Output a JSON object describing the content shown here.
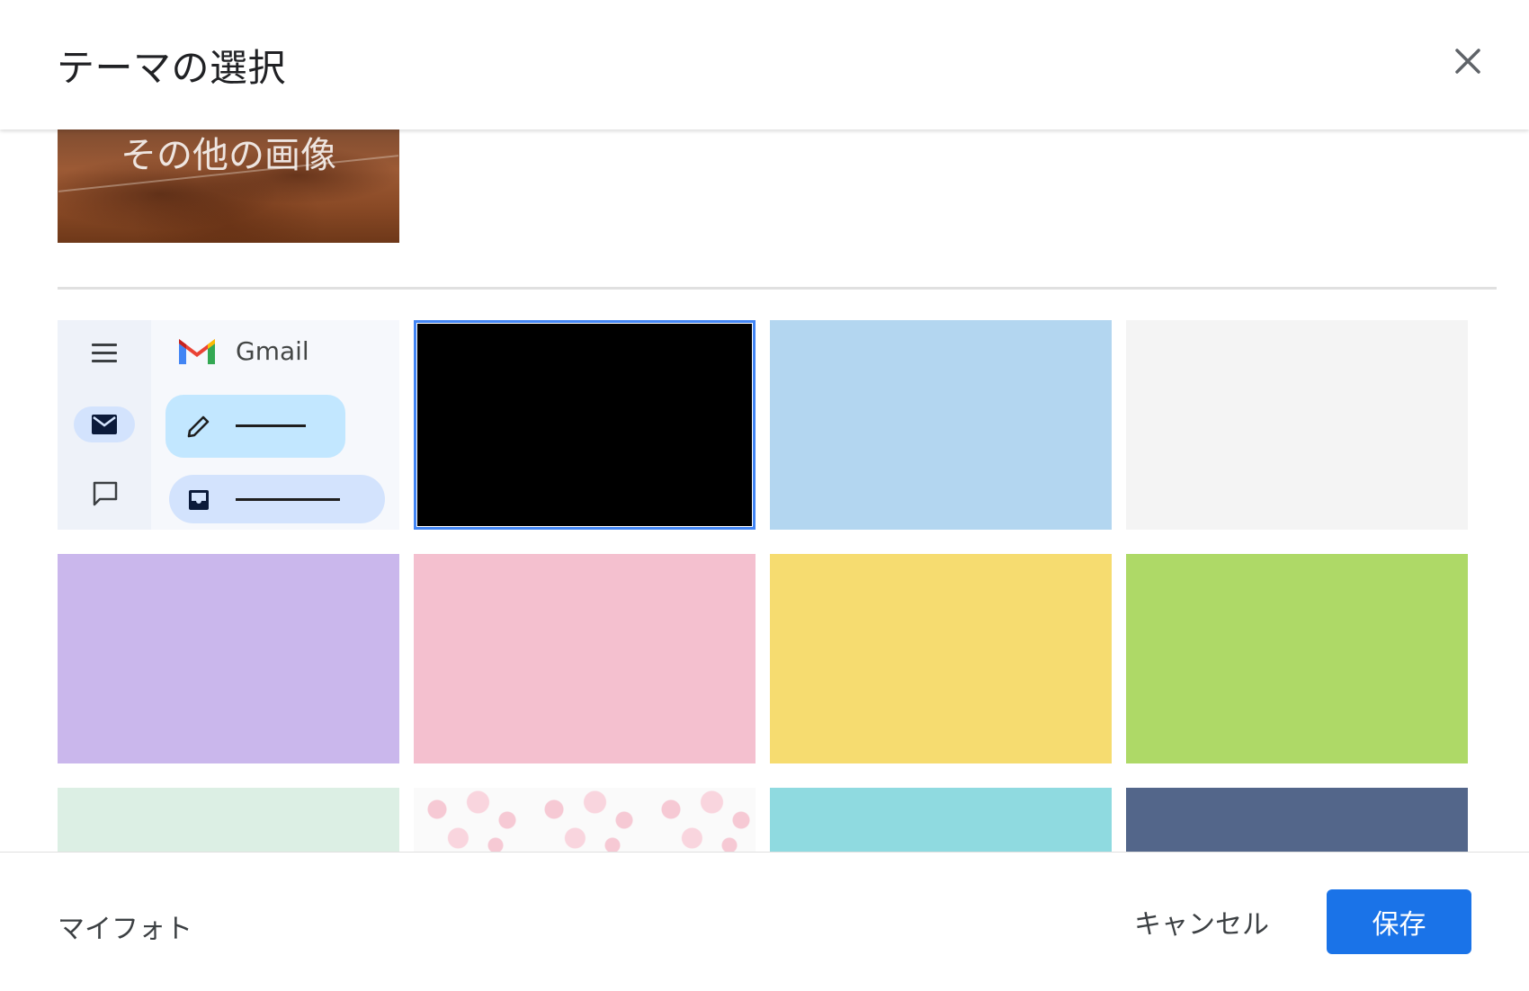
{
  "dialog": {
    "title": "テーマの選択",
    "close_icon": "close-icon"
  },
  "more_images": {
    "label": "その他の画像"
  },
  "themes": {
    "default": {
      "brand": "Gmail",
      "icons": [
        "menu-icon",
        "mail-icon",
        "chat-icon",
        "gmail-logo-icon",
        "pencil-icon",
        "inbox-icon"
      ],
      "colors": {
        "rail": "#eef2f9",
        "compose": "#c2e7ff",
        "pill": "#d3e3fd"
      }
    },
    "swatches": [
      {
        "name": "black",
        "color": "#000000",
        "selected": true
      },
      {
        "name": "light-blue",
        "color": "#b3d6f0"
      },
      {
        "name": "light-gray",
        "color": "#f4f4f4"
      },
      {
        "name": "lavender",
        "color": "#cab7ec"
      },
      {
        "name": "pink",
        "color": "#f4c0cf"
      },
      {
        "name": "yellow",
        "color": "#f6dc70"
      },
      {
        "name": "lime",
        "color": "#aed967"
      },
      {
        "name": "mint",
        "color": "#dcefe4"
      },
      {
        "name": "sakura-pattern",
        "color": "#fafafa"
      },
      {
        "name": "turquoise",
        "color": "#8fdae0"
      },
      {
        "name": "slate-blue",
        "color": "#53668a"
      }
    ]
  },
  "footer": {
    "my_photos": "マイフォト",
    "cancel": "キャンセル",
    "save": "保存"
  },
  "colors": {
    "accent": "#1a73e8",
    "selection_border": "#4285f4"
  }
}
